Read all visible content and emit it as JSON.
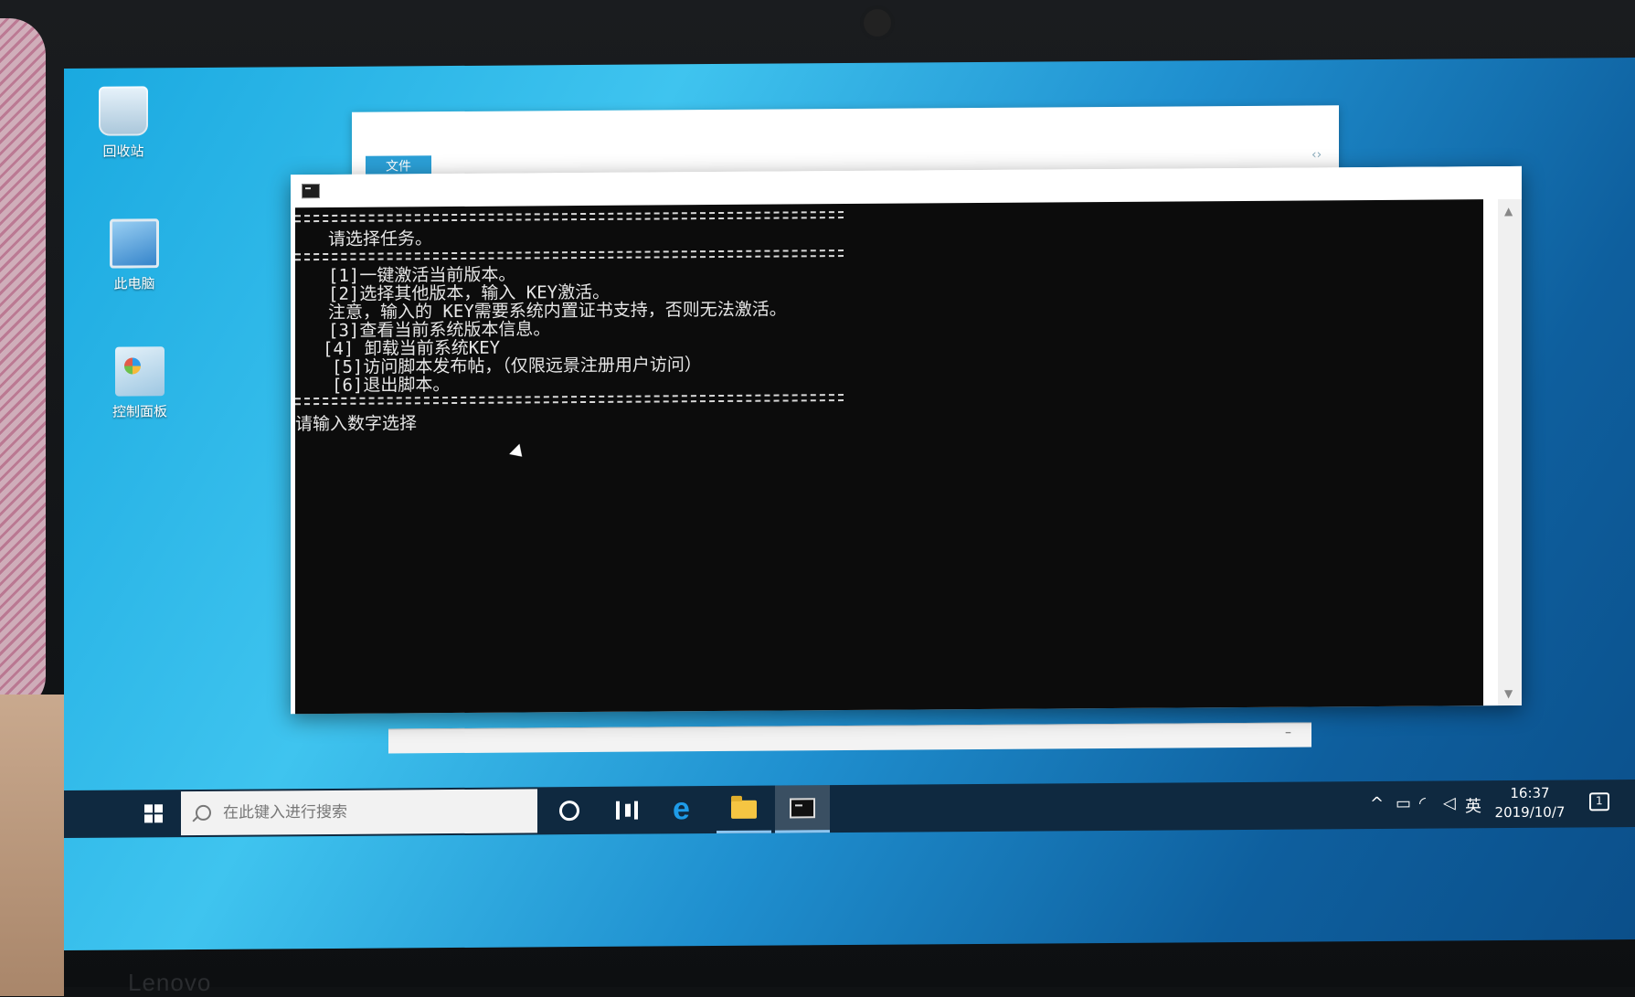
{
  "desktop": {
    "icons": [
      {
        "label": "回收站",
        "icon": "recycle-bin-icon"
      },
      {
        "label": "此电脑",
        "icon": "computer-icon"
      },
      {
        "label": "控制面板",
        "icon": "control-panel-icon"
      }
    ]
  },
  "background_window": {
    "tab_label": "文件"
  },
  "cmd_window": {
    "lines": {
      "prompt_title": "请选择任务。",
      "option1": "[1]一键激活当前版本。",
      "option2": "[2]选择其他版本，输入 KEY激活。",
      "note": "注意，输入的 KEY需要系统内置证书支持，否则无法激活。",
      "option3": "[3]查看当前系统版本信息。",
      "option4": "[4] 卸载当前系统KEY",
      "option5": "[5]访问脚本发布帖，（仅限远景注册用户访问）",
      "option6": "[6]退出脚本。",
      "input_prompt": "请输入数字选择"
    }
  },
  "taskbar": {
    "search_placeholder": "在此键入进行搜索",
    "pinned": [
      "cortana-icon",
      "task-view-icon",
      "edge-icon",
      "file-explorer-icon",
      "cmd-icon"
    ],
    "tray": {
      "ime": "英",
      "time": "16:37",
      "date": "2019/10/7",
      "notification_count": "1"
    }
  },
  "colors": {
    "console_bg": "#0c0c0c",
    "console_fg": "#e6e6e6",
    "taskbar_bg": "#0f2940",
    "accent": "#1e9be8"
  }
}
